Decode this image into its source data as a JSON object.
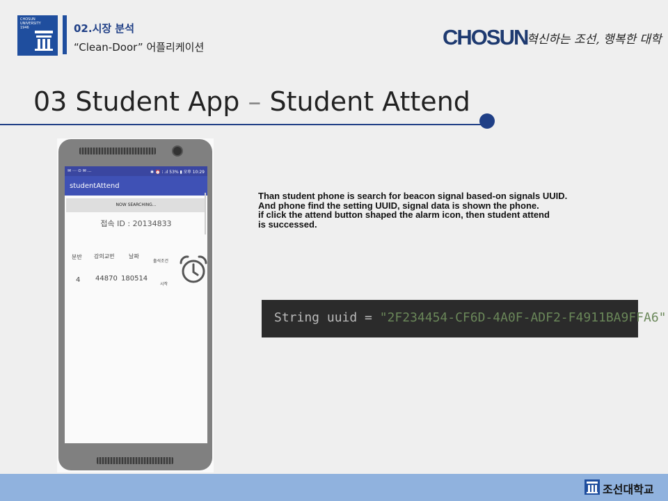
{
  "header": {
    "logo_text": "CHOSUN UNIVERSITY 1946",
    "section": "02.시장 분석",
    "subtitle": "“Clean-Door” 어플리케이션",
    "brand": "CHOSUN",
    "slogan": "혁신하는 조선, 행복한 대학"
  },
  "title": {
    "main": "03 Student App",
    "dash": " – ",
    "sub": "Student Attend"
  },
  "phone": {
    "status_left": "✉ ⋯ ⊙ ✉ ...",
    "status_right": "✱ ⏰ ⁝ .ıl 53% ▮ 오후 10:29",
    "app_title": "studentAttend",
    "search_button": "NOW SEARCHING...",
    "connection": "접속 ID : 20134833",
    "table": {
      "headers": [
        "분반",
        "강의교번",
        "날짜",
        "출석조건"
      ],
      "row": [
        "4",
        "44870",
        "180514",
        "시작"
      ]
    }
  },
  "description": {
    "lines": [
      "Than student phone is search for beacon signal based-on signals UUID.",
      "And phone find the setting UUID, signal data is shown the phone.",
      "if click the attend button shaped the alarm icon, then student attend",
      "is successed."
    ]
  },
  "code": {
    "prefix": "String uuid = ",
    "value": "\"2F234454-CF6D-4A0F-ADF2-F4911BA9FFA6\"",
    "suffix": ";"
  },
  "footer": {
    "university": "조선대학교"
  }
}
